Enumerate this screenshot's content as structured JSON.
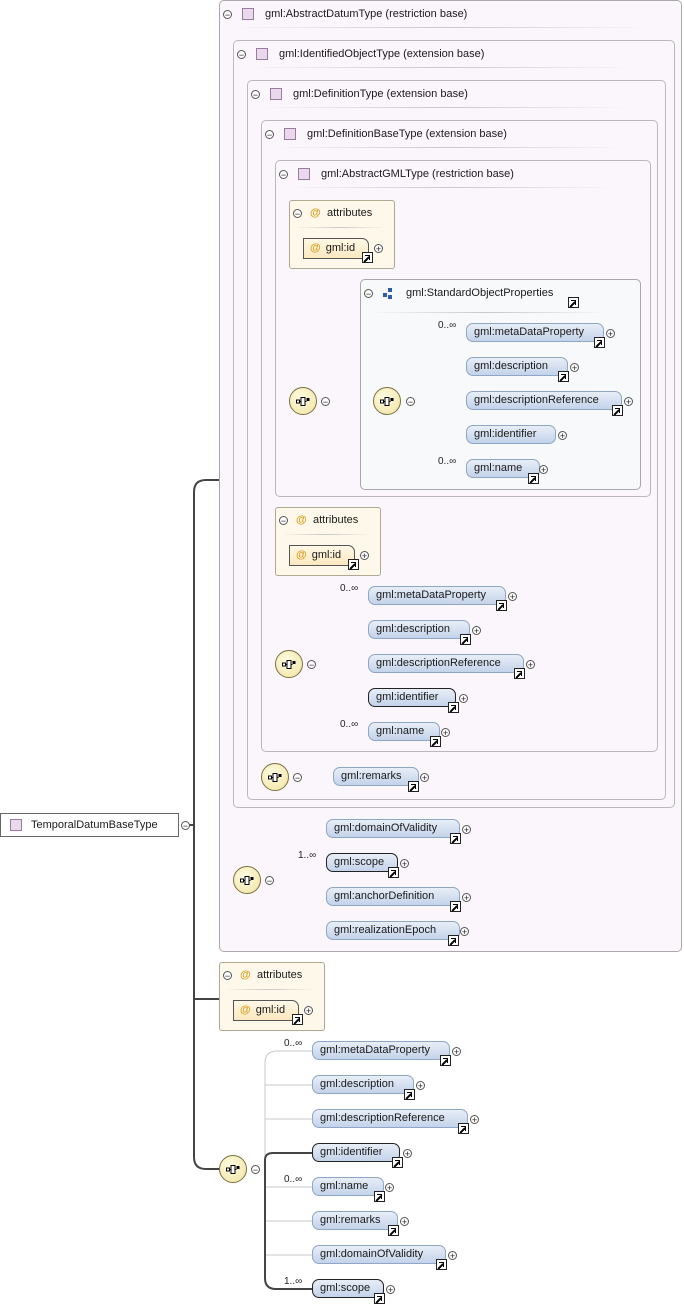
{
  "root": {
    "label": "TemporalDatumBaseType"
  },
  "abstract_datum": {
    "label": "gml:AbstractDatumType (restriction base)"
  },
  "identified_object": {
    "label": "gml:IdentifiedObjectType (extension base)"
  },
  "definition": {
    "label": "gml:DefinitionType (extension base)"
  },
  "definition_base": {
    "label": "gml:DefinitionBaseType (extension base)"
  },
  "abstract_gml": {
    "label": "gml:AbstractGMLType (restriction base)"
  },
  "attributes_label": "attributes",
  "attr_id": "gml:id",
  "at_symbol": "@",
  "minus_symbol": "−",
  "plus_symbol": "+",
  "std_props": {
    "label": "gml:StandardObjectProperties",
    "items": [
      "gml:metaDataProperty",
      "gml:description",
      "gml:descriptionReference",
      "gml:identifier",
      "gml:name"
    ],
    "mult_first": "0..∞",
    "mult_last": "0..∞"
  },
  "defbase_seq": {
    "items": [
      "gml:metaDataProperty",
      "gml:description",
      "gml:descriptionReference",
      "gml:identifier",
      "gml:name"
    ],
    "mult_first": "0..∞",
    "mult_last": "0..∞"
  },
  "definition_seq": {
    "items": [
      "gml:remarks"
    ]
  },
  "datum_seq": {
    "items": [
      "gml:domainOfValidity",
      "gml:scope",
      "gml:anchorDefinition",
      "gml:realizationEpoch"
    ],
    "mult_scope": "1..∞"
  },
  "final_seq": {
    "items": [
      "gml:metaDataProperty",
      "gml:description",
      "gml:descriptionReference",
      "gml:identifier",
      "gml:name",
      "gml:remarks",
      "gml:domainOfValidity",
      "gml:scope"
    ],
    "mult_first": "0..∞",
    "mult_name": "0..∞",
    "mult_scope": "1..∞"
  }
}
